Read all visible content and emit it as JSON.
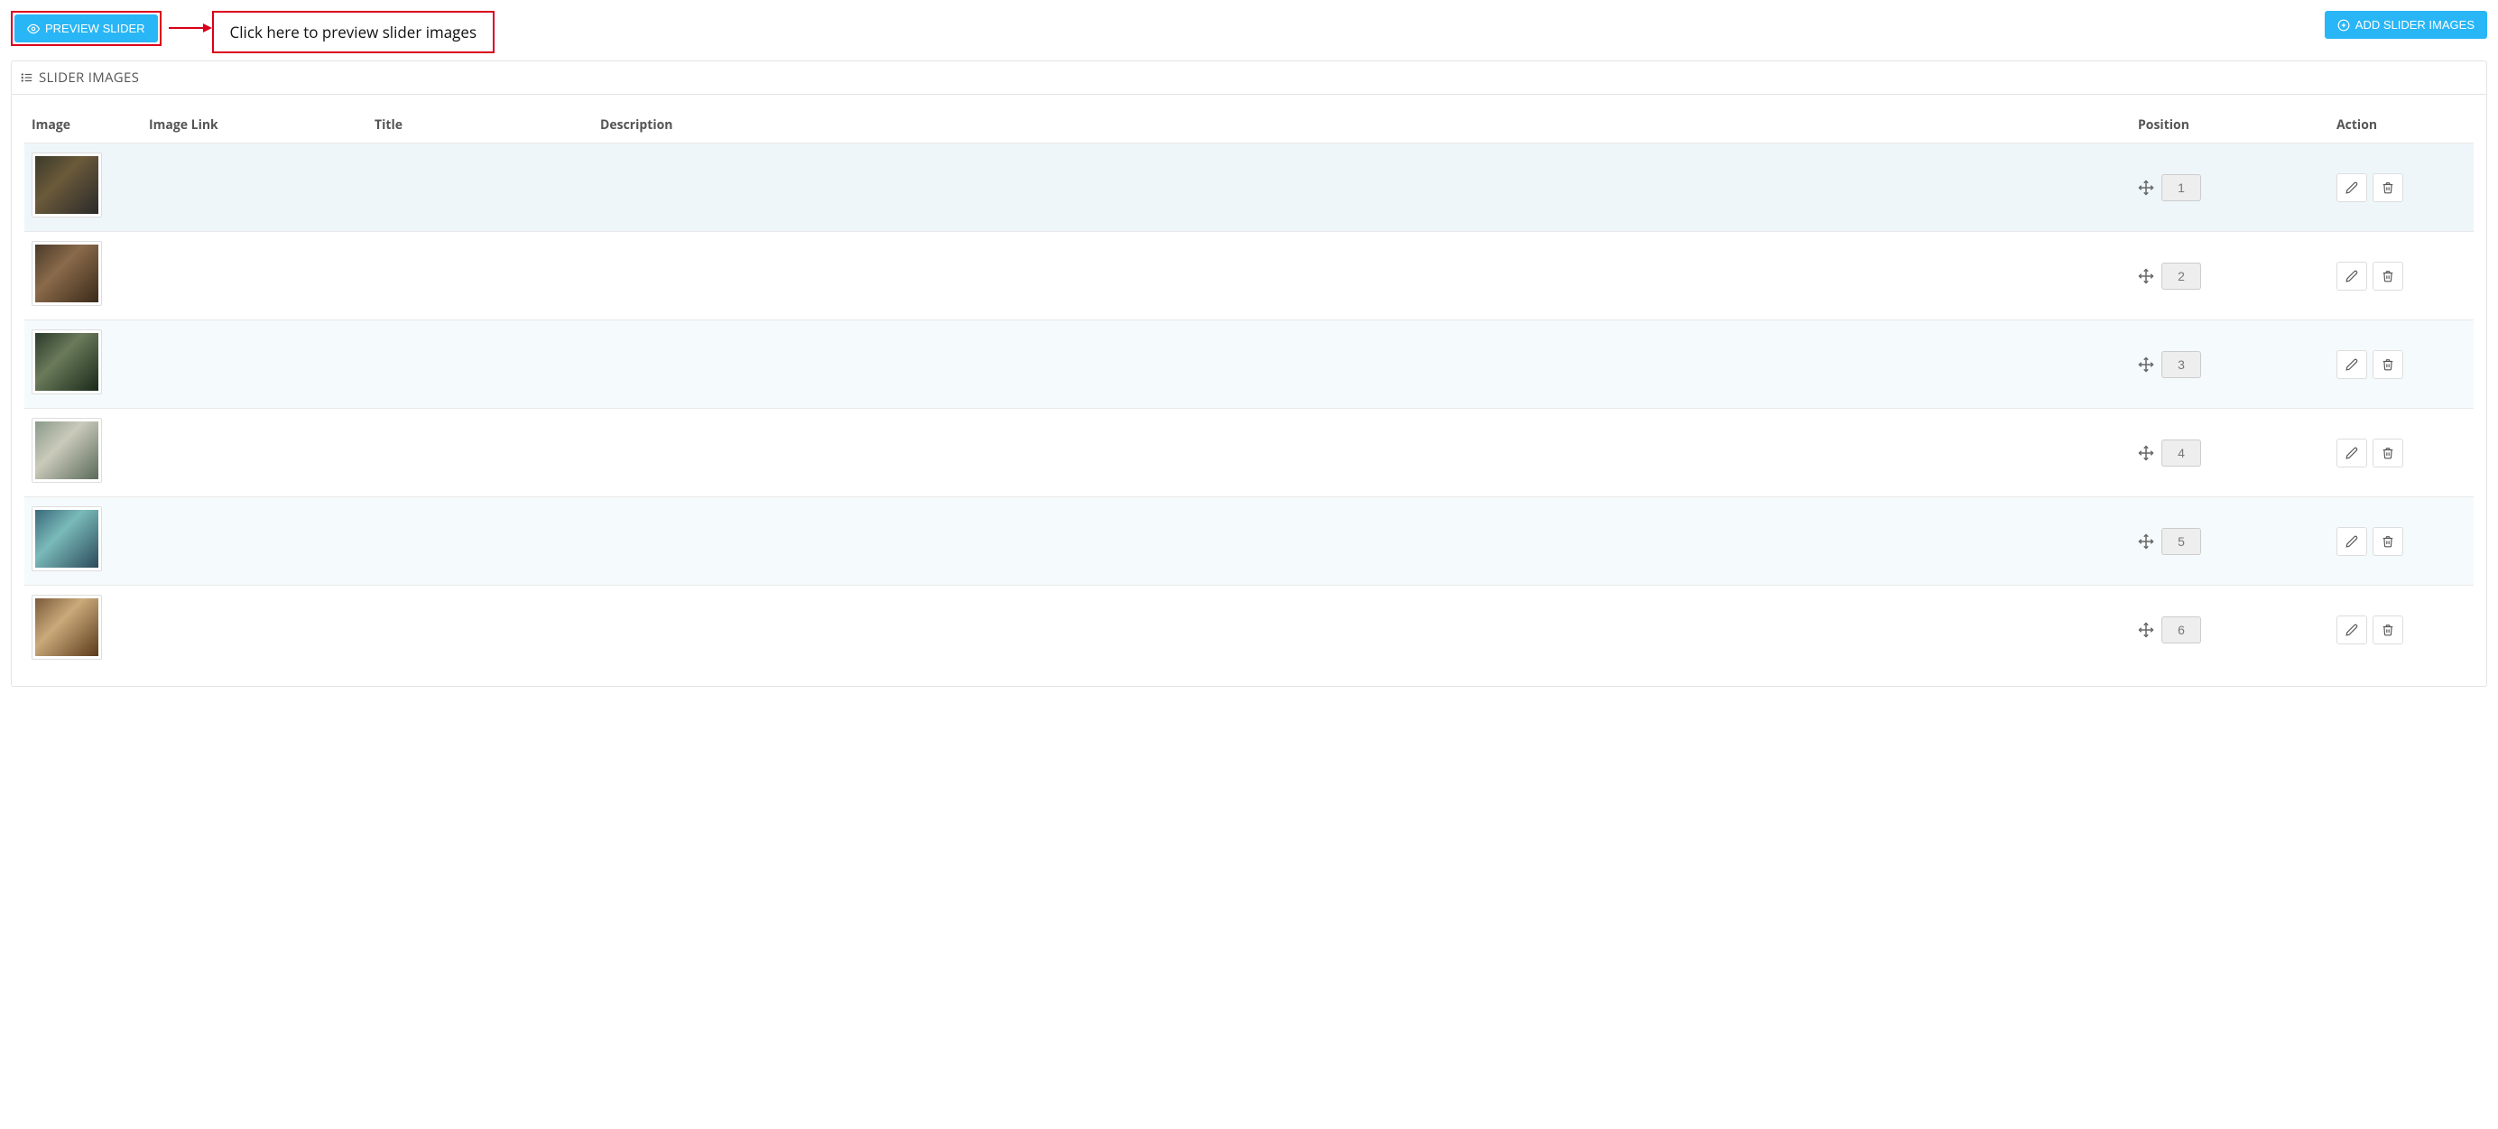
{
  "header": {
    "preview_label": "PREVIEW SLIDER",
    "callout_text": "Click here to preview slider images",
    "add_label": "ADD SLIDER IMAGES"
  },
  "panel": {
    "title": "SLIDER IMAGES"
  },
  "table": {
    "columns": {
      "image": "Image",
      "link": "Image Link",
      "title": "Title",
      "description": "Description",
      "position": "Position",
      "action": "Action"
    },
    "rows": [
      {
        "link": "",
        "title": "",
        "description": "",
        "position": "1"
      },
      {
        "link": "",
        "title": "",
        "description": "",
        "position": "2"
      },
      {
        "link": "",
        "title": "",
        "description": "",
        "position": "3"
      },
      {
        "link": "",
        "title": "",
        "description": "",
        "position": "4"
      },
      {
        "link": "",
        "title": "",
        "description": "",
        "position": "5"
      },
      {
        "link": "",
        "title": "",
        "description": "",
        "position": "6"
      }
    ]
  }
}
